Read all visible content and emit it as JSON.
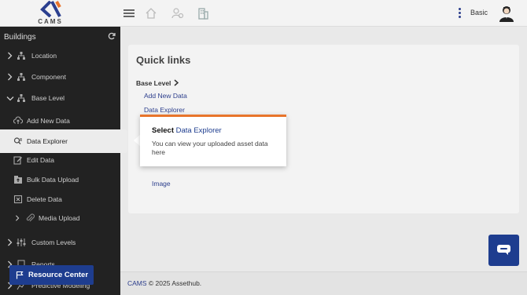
{
  "brand": {
    "logo_text": "CAMS"
  },
  "topbar": {
    "user_mode": "Basic"
  },
  "sidebar": {
    "header": "Buildings",
    "items": [
      {
        "label": "Location"
      },
      {
        "label": "Component"
      },
      {
        "label": "Base Level"
      },
      {
        "label": "Add New Data"
      },
      {
        "label": "Data Explorer"
      },
      {
        "label": "Edit Data"
      },
      {
        "label": "Bulk Data Upload"
      },
      {
        "label": "Delete Data"
      },
      {
        "label": "Media Upload"
      },
      {
        "label": "Custom Levels"
      },
      {
        "label": "Reports"
      },
      {
        "label": "Predictive Modeling"
      }
    ],
    "resource_center": "Resource Center"
  },
  "main": {
    "title": "Quick links",
    "section_label": "Base Level",
    "links": {
      "add": "Add New Data",
      "explorer": "Data Explorer",
      "image": "Image"
    }
  },
  "tooltip": {
    "title_prefix": "Select ",
    "title_highlight": "Data Explorer",
    "body": "You can view your uploaded asset data here"
  },
  "footer": {
    "brand": "CAMS",
    "text": " © 2025 Assethub."
  },
  "colors": {
    "accent": "#1e3d8f",
    "tooltip_border": "#e8742b",
    "sidebar": "#222222"
  }
}
